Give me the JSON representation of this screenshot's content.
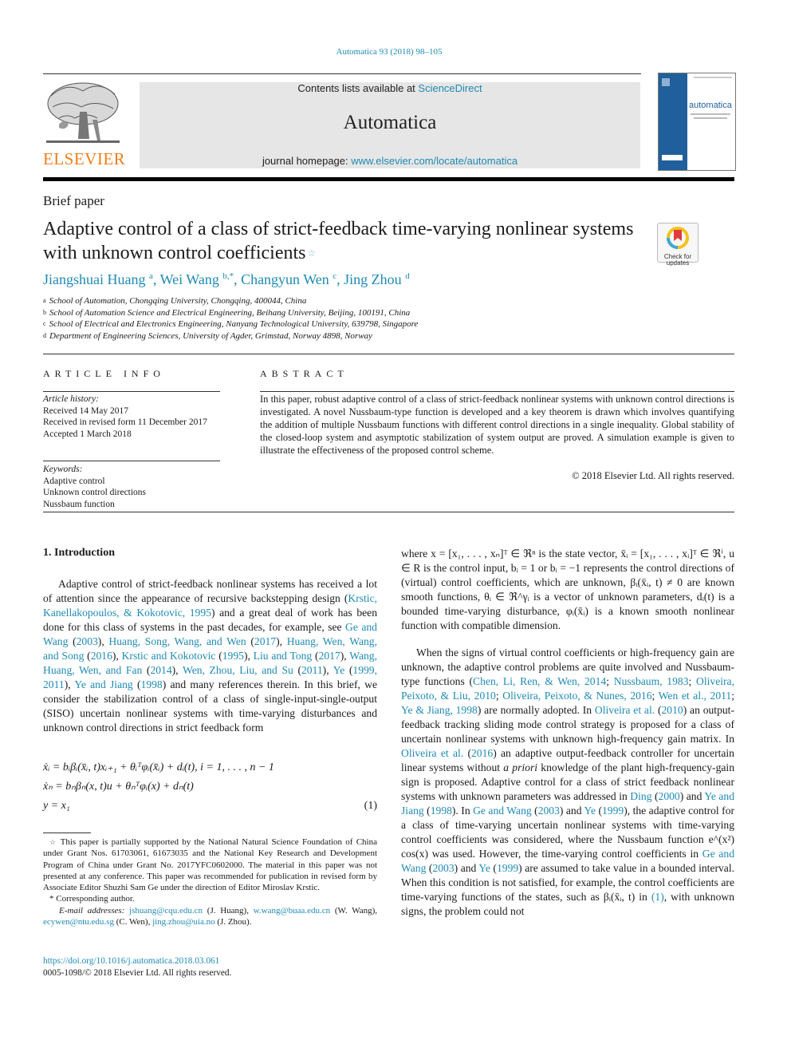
{
  "header": {
    "journal_ref": "Automatica 93 (2018) 98–105",
    "contents_prefix": "Contents lists available at ",
    "contents_link": "ScienceDirect",
    "journal_name": "Automatica",
    "homepage_prefix": "journal homepage: ",
    "homepage_link": "www.elsevier.com/locate/automatica",
    "publisher_logo_text": "ELSEVIER",
    "cover_title": "automatica",
    "brand_colors": {
      "link": "#1f8ab3",
      "elsevier_orange": "#f07d1a",
      "cover_blue": "#1f5f9b"
    }
  },
  "article": {
    "type": "Brief paper",
    "title": "Adaptive control of a class of strict-feedback time-varying nonlinear systems with unknown control coefficients",
    "title_mark": "☆",
    "crossmark_label": "Check for updates",
    "authors": [
      {
        "name": "Jiangshuai Huang",
        "sup": "a"
      },
      {
        "name": "Wei Wang",
        "sup": "b,*"
      },
      {
        "name": "Changyun Wen",
        "sup": "c"
      },
      {
        "name": "Jing Zhou",
        "sup": "d"
      }
    ],
    "affiliations": [
      {
        "mark": "a",
        "text": "School of Automation, Chongqing University, Chongqing, 400044, China"
      },
      {
        "mark": "b",
        "text": "School of Automation Science and Electrical Engineering, Beihang University, Beijing, 100191, China"
      },
      {
        "mark": "c",
        "text": "School of Electrical and Electronics Engineering, Nanyang Technological University, 639798, Singapore"
      },
      {
        "mark": "d",
        "text": "Department of Engineering Sciences, University of Agder, Grimstad, Norway 4898, Norway"
      }
    ]
  },
  "article_info": {
    "heading": "ARTICLE INFO",
    "history_label": "Article history:",
    "history": [
      "Received 14 May 2017",
      "Received in revised form 11 December 2017",
      "Accepted 1 March 2018"
    ],
    "keywords_label": "Keywords:",
    "keywords": [
      "Adaptive control",
      "Unknown control directions",
      "Nussbaum function"
    ]
  },
  "abstract": {
    "heading": "ABSTRACT",
    "text": "In this paper, robust adaptive control of a class of strict-feedback nonlinear systems with unknown control directions is investigated. A novel Nussbaum-type function is developed and a key theorem is drawn which involves quantifying the addition of multiple Nussbaum functions with different control directions in a single inequality. Global stability of the closed-loop system and asymptotic stabilization of system output are proved. A simulation example is given to illustrate the effectiveness of the proposed control scheme.",
    "copyright": "© 2018 Elsevier Ltd. All rights reserved."
  },
  "intro": {
    "heading": "1.  Introduction",
    "p1": [
      {
        "t": "Adaptive control of strict-feedback nonlinear systems has received a lot of attention since the appearance of recursive backstepping design ("
      },
      {
        "t": "Krstic, Kanellakopoulos, & Kokotovic, 1995",
        "link": true
      },
      {
        "t": ") and a great deal of work has been done for this class of systems in the past decades, for example, see "
      },
      {
        "t": "Ge and Wang",
        "link": true
      },
      {
        "t": " ("
      },
      {
        "t": "2003",
        "link": true
      },
      {
        "t": "), "
      },
      {
        "t": "Huang, Song, Wang, and Wen",
        "link": true
      },
      {
        "t": " ("
      },
      {
        "t": "2017",
        "link": true
      },
      {
        "t": "), "
      },
      {
        "t": "Huang, Wen, Wang, and Song",
        "link": true
      },
      {
        "t": " ("
      },
      {
        "t": "2016",
        "link": true
      },
      {
        "t": "), "
      },
      {
        "t": "Krstic and Kokotovic",
        "link": true
      },
      {
        "t": " ("
      },
      {
        "t": "1995",
        "link": true
      },
      {
        "t": "), "
      },
      {
        "t": "Liu and Tong",
        "link": true
      },
      {
        "t": " ("
      },
      {
        "t": "2017",
        "link": true
      },
      {
        "t": "), "
      },
      {
        "t": "Wang, Huang, Wen, and Fan",
        "link": true
      },
      {
        "t": " ("
      },
      {
        "t": "2014",
        "link": true
      },
      {
        "t": "), "
      },
      {
        "t": "Wen, Zhou, Liu, and Su",
        "link": true
      },
      {
        "t": " ("
      },
      {
        "t": "2011",
        "link": true
      },
      {
        "t": "), "
      },
      {
        "t": "Ye",
        "link": true
      },
      {
        "t": " ("
      },
      {
        "t": "1999, 2011",
        "link": true
      },
      {
        "t": "), "
      },
      {
        "t": "Ye and Jiang",
        "link": true
      },
      {
        "t": " ("
      },
      {
        "t": "1998",
        "link": true
      },
      {
        "t": ") and many references therein. In this brief, we consider the stabilization control of a class of single-input-single-output (SISO) uncertain nonlinear systems with time-varying disturbances and unknown control directions in strict feedback form"
      }
    ],
    "equation_lines": [
      "ẋᵢ = bᵢβᵢ(x̄ᵢ, t)xᵢ₊₁ + θᵢᵀφᵢ(x̄ᵢ) + dᵢ(t), i = 1, . . . , n − 1",
      "ẋₙ = bₙβₙ(x, t)u + θₙᵀφᵢ(x) + dₙ(t)",
      "y = x₁"
    ],
    "equation_number": "(1)"
  },
  "right_column": {
    "p1": "where x = [x₁, . . . , xₙ]ᵀ ∈ ℜⁿ is the state vector, x̄ᵢ = [x₁, . . . , xᵢ]ᵀ ∈ ℜⁱ, u ∈ R is the control input, bᵢ = 1 or bᵢ = −1 represents the control directions of (virtual) control coefficients, which are unknown, βᵢ(x̄ᵢ, t) ≠ 0 are known smooth functions, θᵢ ∈ ℜ^γᵢ is a vector of unknown parameters, dᵢ(t) is a bounded time-varying disturbance, φᵢ(x̄ᵢ) is a known smooth nonlinear function with compatible dimension.",
    "p2": [
      {
        "t": "When the signs of virtual control coefficients or high-frequency gain are unknown, the adaptive control problems are quite involved and Nussbaum-type functions ("
      },
      {
        "t": "Chen, Li, Ren, & Wen, 2014",
        "link": true
      },
      {
        "t": "; "
      },
      {
        "t": "Nussbaum, 1983",
        "link": true
      },
      {
        "t": "; "
      },
      {
        "t": "Oliveira, Peixoto, & Liu, 2010",
        "link": true
      },
      {
        "t": "; "
      },
      {
        "t": "Oliveira, Peixoto, & Nunes, 2016",
        "link": true
      },
      {
        "t": "; "
      },
      {
        "t": "Wen et al., 2011",
        "link": true
      },
      {
        "t": "; "
      },
      {
        "t": "Ye & Jiang, 1998",
        "link": true
      },
      {
        "t": ") are normally adopted. In "
      },
      {
        "t": "Oliveira et al.",
        "link": true
      },
      {
        "t": " ("
      },
      {
        "t": "2010",
        "link": true
      },
      {
        "t": ") an output-feedback tracking sliding mode control strategy is proposed for a class of uncertain nonlinear systems with unknown high-frequency gain matrix. In "
      },
      {
        "t": "Oliveira et al.",
        "link": true
      },
      {
        "t": " ("
      },
      {
        "t": "2016",
        "link": true
      },
      {
        "t": ") an adaptive output-feedback controller for uncertain linear systems without "
      },
      {
        "t": "a priori",
        "italic": true
      },
      {
        "t": " knowledge of the plant high-frequency-gain sign is proposed. Adaptive control for a class of strict feedback nonlinear systems with unknown parameters was addressed in "
      },
      {
        "t": "Ding",
        "link": true
      },
      {
        "t": " ("
      },
      {
        "t": "2000",
        "link": true
      },
      {
        "t": ") and "
      },
      {
        "t": "Ye and Jiang",
        "link": true
      },
      {
        "t": " ("
      },
      {
        "t": "1998",
        "link": true
      },
      {
        "t": "). In "
      },
      {
        "t": "Ge and Wang",
        "link": true
      },
      {
        "t": " ("
      },
      {
        "t": "2003",
        "link": true
      },
      {
        "t": ") and "
      },
      {
        "t": "Ye",
        "link": true
      },
      {
        "t": " ("
      },
      {
        "t": "1999",
        "link": true
      },
      {
        "t": "), the adaptive control for a class of time-varying uncertain nonlinear systems with time-varying control coefficients was considered, where the Nussbaum function e^(x²) cos(x) was used. However, the time-varying control coefficients in "
      },
      {
        "t": "Ge and Wang",
        "link": true
      },
      {
        "t": " ("
      },
      {
        "t": "2003",
        "link": true
      },
      {
        "t": ") and "
      },
      {
        "t": "Ye",
        "link": true
      },
      {
        "t": " ("
      },
      {
        "t": "1999",
        "link": true
      },
      {
        "t": ") are assumed to take value in a bounded interval. When this condition is not satisfied, for example, the control coefficients are time-varying functions of the states, such as βᵢ(x̄ᵢ, t) in "
      },
      {
        "t": "(1)",
        "link": true
      },
      {
        "t": ", with unknown signs, the problem could not"
      }
    ]
  },
  "footnotes": {
    "star_mark": "☆",
    "funding": "This paper is partially supported by the National Natural Science Foundation of China under Grant Nos. 61703061, 61673035 and the National Key Research and Development Program of China under Grant No. 2017YFC0602000. The material in this paper was not presented at any conference. This paper was recommended for publication in revised form by Associate Editor Shuzhi Sam Ge under the direction of Editor Miroslav Krstic.",
    "corresponding_mark": "*",
    "corresponding": "Corresponding author.",
    "email_label": "E-mail addresses:",
    "emails": [
      {
        "address": "jshuang@cqu.edu.cn",
        "who": "(J. Huang)"
      },
      {
        "address": "w.wang@buaa.edu.cn",
        "who": "(W. Wang)"
      },
      {
        "address": "ecywen@ntu.edu.sg",
        "who": "(C. Wen)"
      },
      {
        "address": "jing.zhou@uia.no",
        "who": "(J. Zhou)"
      }
    ],
    "doi": "https://doi.org/10.1016/j.automatica.2018.03.061",
    "issn_copyright": "0005-1098/© 2018 Elsevier Ltd. All rights reserved."
  }
}
